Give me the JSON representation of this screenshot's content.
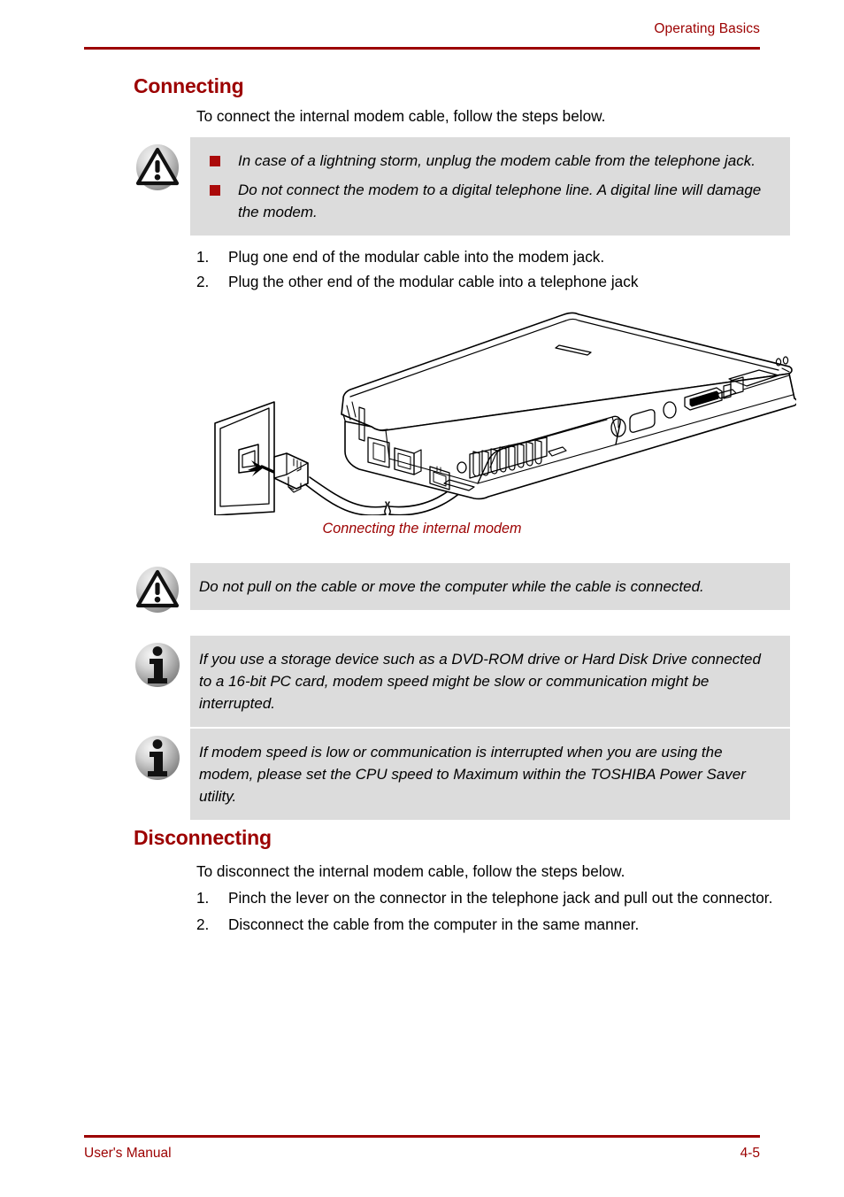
{
  "header": {
    "chapter_title": "Operating Basics"
  },
  "footer": {
    "left_label": "User's Manual",
    "page_number": "4-5"
  },
  "colors": {
    "accent_red": "#9c0000",
    "bullet_red": "#ab0a0a",
    "notice_bg": "#dcdcdc",
    "page_bg": "#ffffff"
  },
  "sections": {
    "connecting": {
      "heading": "Connecting",
      "intro": "To connect the internal modem cable, follow the steps below.",
      "steps": [
        {
          "num": "1.",
          "text": "Plug one end of the modular cable into the modem jack."
        },
        {
          "num": "2.",
          "text": "Plug the other end of the modular cable into a telephone jack"
        }
      ]
    },
    "disconnecting": {
      "heading": "Disconnecting",
      "intro": "To disconnect the internal modem cable, follow the steps below.",
      "steps": [
        {
          "num": "1.",
          "text": "Pinch the lever on the connector in the telephone jack and pull out the connector."
        },
        {
          "num": "2.",
          "text": "Disconnect the cable from the computer in the same manner."
        }
      ]
    }
  },
  "notices": {
    "warning_lightning": {
      "icon": "warning-triangle-icon",
      "bullets": [
        "In case of a lightning storm, unplug the modem cable from the telephone jack.",
        "Do not connect the modem to a digital telephone line. A digital line will damage the modem."
      ]
    },
    "caution_cable": {
      "icon": "warning-triangle-icon",
      "text": "Do not pull on the cable or move the computer while the cable is connected."
    },
    "info_storage": {
      "icon": "info-circle-icon",
      "text": "If you use a storage device such as a DVD-ROM drive or Hard Disk Drive connected to a 16-bit PC card, modem speed might be slow or communication might be interrupted."
    },
    "info_cpu_speed": {
      "icon": "info-circle-icon",
      "text": "If modem speed is low or communication is interrupted when you are using the modem, please set the CPU speed to Maximum within the TOSHIBA Power Saver utility."
    }
  },
  "figure": {
    "caption": "Connecting the internal modem",
    "description": "Line drawing of a notebook computer rear view with a modular telephone cable connecting its modem jack to a telephone wall jack"
  }
}
